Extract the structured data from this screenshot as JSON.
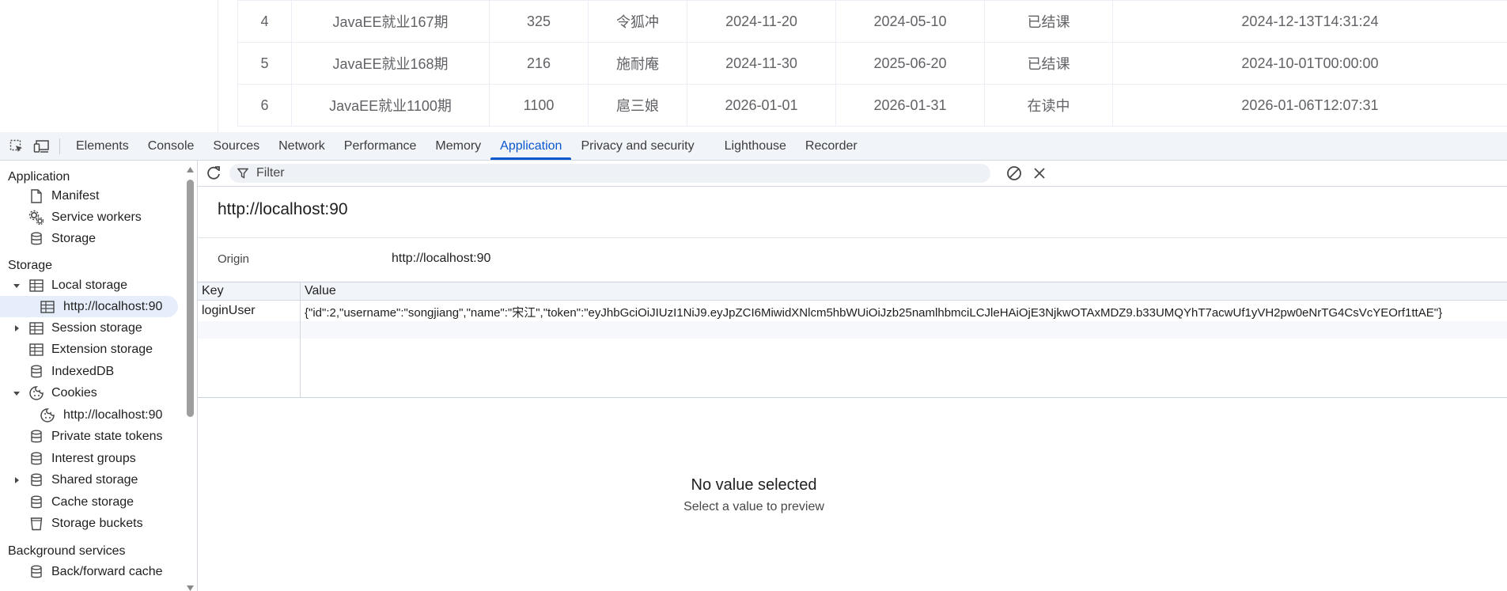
{
  "table": {
    "rows": [
      [
        "4",
        "JavaEE就业167期",
        "325",
        "令狐冲",
        "2024-11-20",
        "2024-05-10",
        "已结课",
        "2024-12-13T14:31:24"
      ],
      [
        "5",
        "JavaEE就业168期",
        "216",
        "施耐庵",
        "2024-11-30",
        "2025-06-20",
        "已结课",
        "2024-10-01T00:00:00"
      ],
      [
        "6",
        "JavaEE就业1100期",
        "1100",
        "扈三娘",
        "2026-01-01",
        "2026-01-31",
        "在读中",
        "2026-01-06T12:07:31"
      ]
    ]
  },
  "devtools": {
    "tabs": [
      "Elements",
      "Console",
      "Sources",
      "Network",
      "Performance",
      "Memory",
      "Application",
      "Privacy and security",
      "Lighthouse",
      "Recorder"
    ],
    "active_tab": "Application",
    "accent_color": "#0b57d0"
  },
  "sidebar": {
    "application_heading": "Application",
    "application_items": [
      "Manifest",
      "Service workers",
      "Storage"
    ],
    "storage_heading": "Storage",
    "local_storage": "Local storage",
    "local_storage_origin": "http://localhost:90",
    "session_storage": "Session storage",
    "extension_storage": "Extension storage",
    "indexeddb": "IndexedDB",
    "cookies": "Cookies",
    "cookies_origin": "http://localhost:90",
    "private_state_tokens": "Private state tokens",
    "interest_groups": "Interest groups",
    "shared_storage": "Shared storage",
    "cache_storage": "Cache storage",
    "storage_buckets": "Storage buckets",
    "background_heading": "Background services",
    "bfcache": "Back/forward cache"
  },
  "main": {
    "filter_placeholder": "Filter",
    "origin_title": "http://localhost:90",
    "origin_label": "Origin",
    "origin_value": "http://localhost:90",
    "grid": {
      "key_header": "Key",
      "value_header": "Value",
      "row_key": "loginUser",
      "row_value": "{\"id\":2,\"username\":\"songjiang\",\"name\":\"宋江\",\"token\":\"eyJhbGciOiJIUzI1NiJ9.eyJpZCI6MiwidXNlcm5hbWUiOiJzb25namlhbmciLCJleHAiOjE3NjkwOTAxMDZ9.b33UMQYhT7acwUf1yVH2pw0eNrTG4CsVcYEOrf1ttAE\"}"
    },
    "preview_title": "No value selected",
    "preview_subtitle": "Select a value to preview"
  }
}
